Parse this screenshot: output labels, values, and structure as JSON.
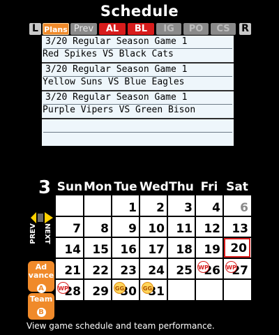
{
  "title": "Schedule",
  "shoulders": {
    "left": "L",
    "right": "R"
  },
  "tabs": [
    "Plans",
    "Prev",
    "AL",
    "BL",
    "IG",
    "PO",
    "CS"
  ],
  "games": [
    {
      "title": "3/20 Regular Season Game 1",
      "matchup": "Red Spikes  VS  Black Cats"
    },
    {
      "title": "3/20 Regular Season Game 1",
      "matchup": "Yellow Suns  VS  Blue Eagles"
    },
    {
      "title": "3/20 Regular Season Game 1",
      "matchup": "Purple Vipers  VS  Green Bison"
    }
  ],
  "calendar": {
    "month": "3",
    "weekdays": [
      "Sun",
      "Mon",
      "Tue",
      "Wed",
      "Thu",
      "Fri",
      "Sat"
    ],
    "today": 20,
    "markers": [
      {
        "day": 26,
        "type": "WP"
      },
      {
        "day": 27,
        "type": "WP"
      },
      {
        "day": 28,
        "type": "WP"
      },
      {
        "day": 30,
        "type": "GG"
      },
      {
        "day": 31,
        "type": "GG"
      }
    ],
    "previous_days": [
      6
    ]
  },
  "nav": {
    "prev": "PREV",
    "next": "NEXT"
  },
  "buttons": {
    "advance_label": "Ad vance",
    "advance_key": "A",
    "team_label": "Team",
    "team_key": "B"
  },
  "hint": "View game schedule and team performance.",
  "colors": {
    "accent": "#f08a2a",
    "league": "#d81c1c",
    "today_border": "#d81c1c"
  }
}
